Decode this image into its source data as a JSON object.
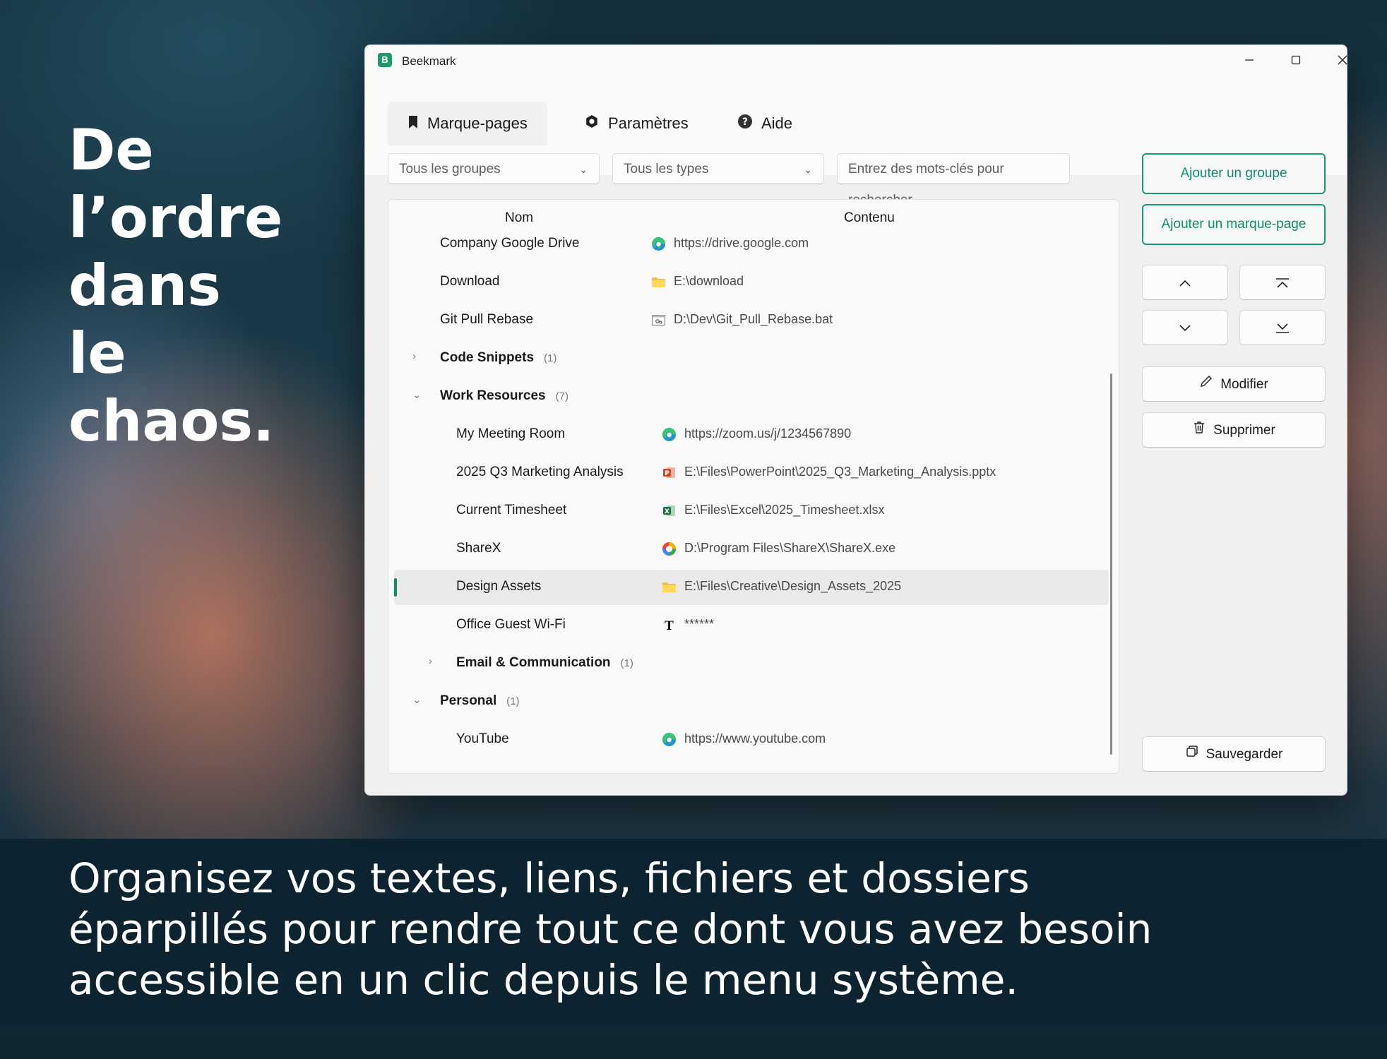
{
  "hero": {
    "headline": [
      "De",
      "l’ordre",
      "dans",
      "le",
      "chaos."
    ],
    "tagline": [
      "Organisez vos textes, liens, fichiers et dossiers",
      "éparpillés pour rendre tout ce dont vous avez besoin",
      "accessible en un clic depuis le menu système."
    ]
  },
  "window": {
    "app_icon_letter": "B",
    "title": "Beekmark",
    "controls": {
      "minimize": "—",
      "maximize": "☐",
      "close": "✕"
    }
  },
  "tabs": [
    {
      "label": "Marque-pages",
      "icon": "bookmark-icon",
      "active": true
    },
    {
      "label": "Paramètres",
      "icon": "gear-icon",
      "active": false
    },
    {
      "label": "Aide",
      "icon": "help-icon",
      "active": false
    }
  ],
  "filters": {
    "group_select": "Tous les groupes",
    "type_select": "Tous les types",
    "search_placeholder": "Entrez des mots-clés pour rechercher..."
  },
  "list": {
    "columns": {
      "name": "Nom",
      "content": "Contenu"
    },
    "rows": [
      {
        "kind": "item",
        "name": "Company Google Drive",
        "content": "https://drive.google.com",
        "icon": "edge-icon"
      },
      {
        "kind": "item",
        "name": "Download",
        "content": "E:\\download",
        "icon": "folder-icon"
      },
      {
        "kind": "item",
        "name": "Git Pull Rebase",
        "content": "D:\\Dev\\Git_Pull_Rebase.bat",
        "icon": "batch-file-icon"
      },
      {
        "kind": "group",
        "name": "Code Snippets",
        "count": "(1)",
        "expanded": false
      },
      {
        "kind": "group",
        "name": "Work Resources",
        "count": "(7)",
        "expanded": true
      },
      {
        "kind": "item",
        "name": "My Meeting Room",
        "content": "https://zoom.us/j/1234567890",
        "icon": "edge-icon"
      },
      {
        "kind": "item",
        "name": "2025 Q3 Marketing Analysis",
        "content": "E:\\Files\\PowerPoint\\2025_Q3_Marketing_Analysis.pptx",
        "icon": "powerpoint-icon"
      },
      {
        "kind": "item",
        "name": "Current Timesheet",
        "content": "E:\\Files\\Excel\\2025_Timesheet.xlsx",
        "icon": "excel-icon"
      },
      {
        "kind": "item",
        "name": "ShareX",
        "content": "D:\\Program Files\\ShareX\\ShareX.exe",
        "icon": "sharex-icon"
      },
      {
        "kind": "item",
        "name": "Design Assets",
        "content": "E:\\Files\\Creative\\Design_Assets_2025",
        "icon": "folder-icon",
        "selected": true
      },
      {
        "kind": "item",
        "name": "Office Guest Wi-Fi",
        "content": "******",
        "icon": "text-icon"
      },
      {
        "kind": "group",
        "name": "Email & Communication",
        "count": "(1)",
        "expanded": false
      },
      {
        "kind": "group",
        "name": "Personal",
        "count": "(1)",
        "expanded": true
      },
      {
        "kind": "item",
        "name": "YouTube",
        "content": "https://www.youtube.com",
        "icon": "edge-icon"
      }
    ]
  },
  "actions": {
    "add_group": "Ajouter un groupe",
    "add_bookmark": "Ajouter un marque-page",
    "edit": "Modifier",
    "delete": "Supprimer",
    "save": "Sauvegarder"
  },
  "colors": {
    "accent": "#1a9a7a",
    "window_bg": "#f3f3f3",
    "list_bg": "#f9f9f9"
  }
}
